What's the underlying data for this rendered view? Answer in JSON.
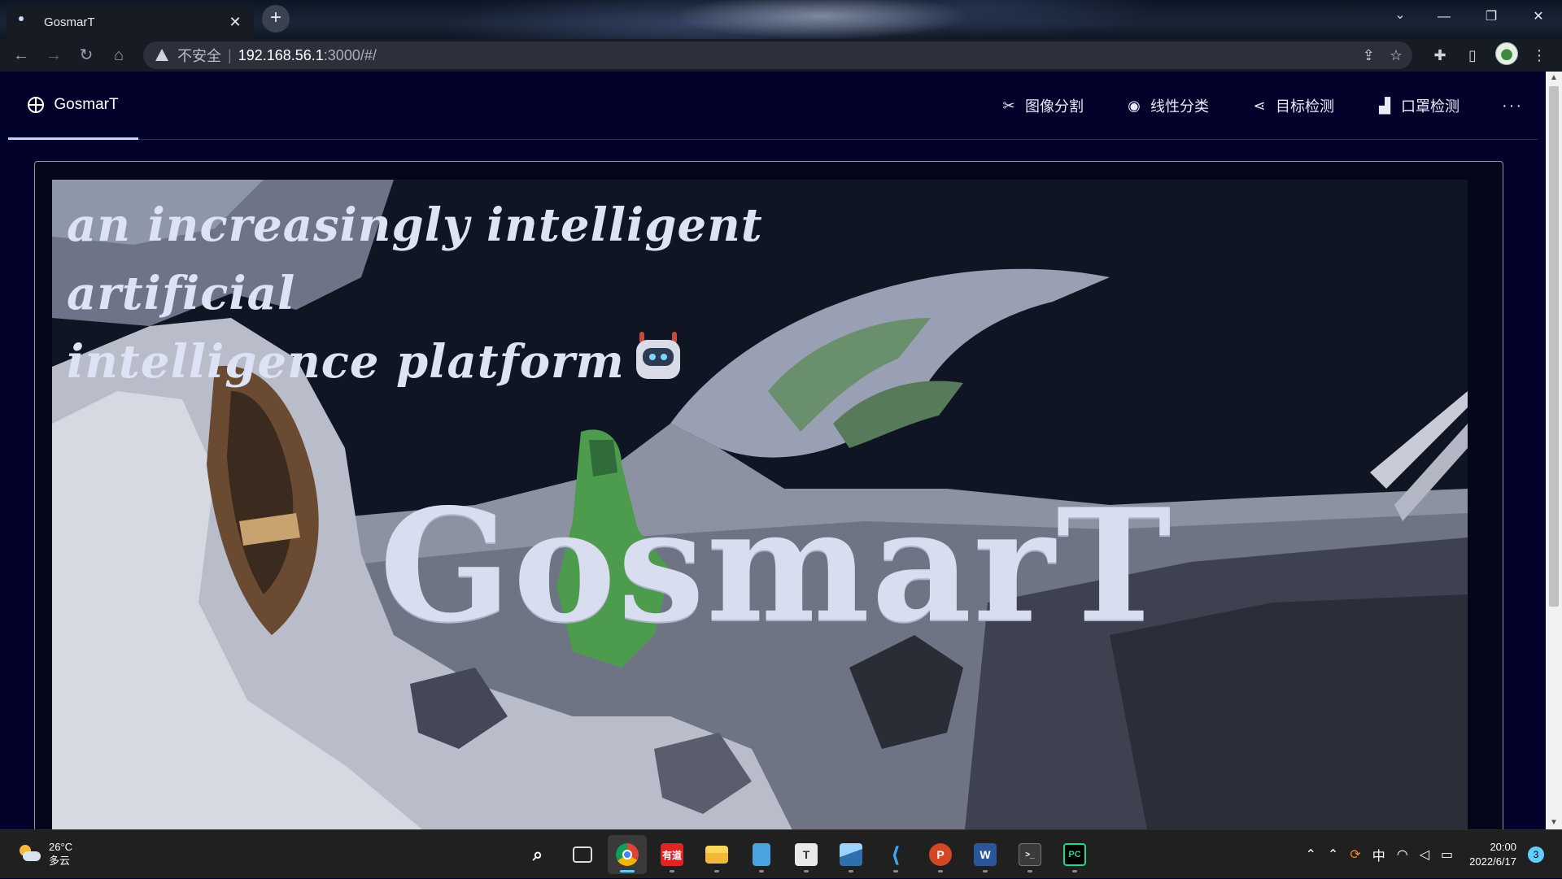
{
  "browser": {
    "tab_title": "GosmarT",
    "tab_close": "✕",
    "new_tab": "+",
    "security_label": "不安全",
    "url_host": "192.168.56.1",
    "url_rest": ":3000/#/"
  },
  "app": {
    "brand": "GosmarT",
    "menu": [
      {
        "label": "图像分割",
        "icon": "scissors-icon"
      },
      {
        "label": "线性分类",
        "icon": "eye-icon"
      },
      {
        "label": "目标检测",
        "icon": "share-icon"
      },
      {
        "label": "口罩检测",
        "icon": "mask-icon"
      }
    ],
    "more": "···"
  },
  "hero": {
    "tagline_line1": "an increasingly intelligent artificial",
    "tagline_line2": "intelligence platform",
    "title": "GosmarT"
  },
  "taskbar": {
    "temperature": "26°C",
    "weather": "多云",
    "ime": "中",
    "time": "20:00",
    "date": "2022/6/17",
    "notifications": "3",
    "apps": [
      {
        "name": "start",
        "label": "",
        "color": "#3aa0ff"
      },
      {
        "name": "search",
        "label": "",
        "color": "#202020"
      },
      {
        "name": "task-view",
        "label": "",
        "color": "#202020"
      },
      {
        "name": "chrome",
        "label": "",
        "color": "#202020"
      },
      {
        "name": "youdao",
        "label": "有道",
        "color": "#e02424"
      },
      {
        "name": "file-explorer",
        "label": "",
        "color": "#f4c542"
      },
      {
        "name": "notepad",
        "label": "",
        "color": "#4aa3df"
      },
      {
        "name": "typora",
        "label": "T",
        "color": "#e9e9e9"
      },
      {
        "name": "photos",
        "label": "",
        "color": "#2f6fb0"
      },
      {
        "name": "vscode",
        "label": "",
        "color": "#202020"
      },
      {
        "name": "powerpoint",
        "label": "P",
        "color": "#d24726"
      },
      {
        "name": "word",
        "label": "W",
        "color": "#2b579a"
      },
      {
        "name": "terminal",
        "label": "",
        "color": "#3b3b3b"
      },
      {
        "name": "pycharm",
        "label": "PC",
        "color": "#21d789"
      }
    ]
  }
}
